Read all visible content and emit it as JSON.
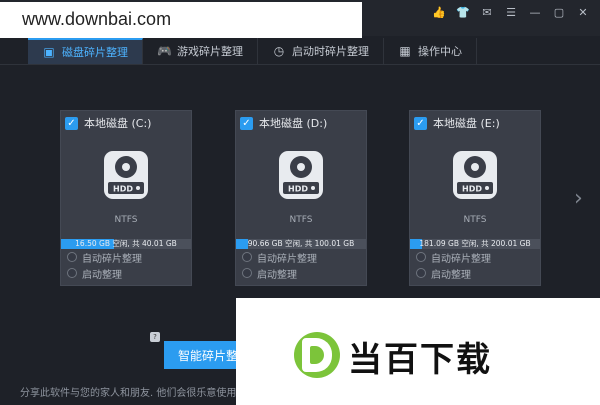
{
  "watermark": {
    "text": "www.downbai.com"
  },
  "title_icons": [
    "thumbs-up-icon",
    "shirt-icon",
    "mail-icon",
    "menu-icon",
    "minimize-icon",
    "restore-icon",
    "close-icon"
  ],
  "tabs": [
    {
      "label": "磁盘碎片整理",
      "icon": "disk-icon",
      "active": true
    },
    {
      "label": "游戏碎片整理",
      "icon": "gamepad-icon",
      "active": false
    },
    {
      "label": "启动时碎片整理",
      "icon": "clock-icon",
      "active": false
    },
    {
      "label": "操作中心",
      "icon": "grid-icon",
      "active": false
    }
  ],
  "drives": [
    {
      "label": "本地磁盘 (C:)",
      "fs": "NTFS",
      "usage": "16.50 GB 空闲, 共 40.01 GB",
      "free_fraction": 0.41,
      "opt_auto": "自动碎片整理",
      "opt_boot": "启动整理"
    },
    {
      "label": "本地磁盘 (D:)",
      "fs": "NTFS",
      "usage": "90.66 GB 空闲, 共 100.01 GB",
      "free_fraction": 0.09,
      "opt_auto": "自动碎片整理",
      "opt_boot": "启动整理"
    },
    {
      "label": "本地磁盘 (E:)",
      "fs": "NTFS",
      "usage": "181.09 GB 空闲, 共 200.01 GB",
      "free_fraction": 0.09,
      "opt_auto": "自动碎片整理",
      "opt_boot": "启动整理"
    }
  ],
  "hdd_text": "HDD",
  "main_button": "智能碎片整理",
  "share_text": "分享此软件与您的家人和朋友. 他们会很乐意使用",
  "overlay_logo_text": "当百下载",
  "colors": {
    "accent": "#2b9cf0",
    "logo_green": "#7cc43a"
  }
}
